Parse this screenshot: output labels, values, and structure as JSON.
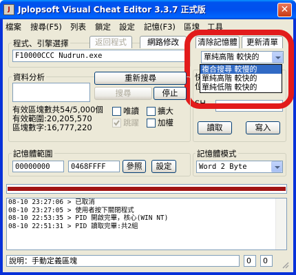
{
  "window": {
    "title": "Jplopsoft Visual Cheat Editor 3.3.7 正式版",
    "icon_text": "J",
    "close_glyph": "✕"
  },
  "menu": [
    "檔案",
    "搜尋(F5)",
    "列表",
    "鎖定",
    "設定",
    "記憶(F3)",
    "區塊",
    "工具"
  ],
  "program": {
    "group_label": "程式、引擎選擇",
    "tabs": [
      "返回程式",
      "網路修改"
    ],
    "process": "F10000CCC Nudrun.exe"
  },
  "memory_tabs": [
    "清除記憶體",
    "更新清單"
  ],
  "search_mode": {
    "selected": "單純高階 較快的",
    "options": [
      "複合搜尋 較慢的",
      "單純高階 較快的",
      "單純低階 較快的"
    ],
    "selected_index": 0
  },
  "right_panel": {
    "partial_label_1": "快",
    "partial_label_2": "位",
    "partial_label_3": "SH",
    "read_button": "讀取",
    "write_button": "寫入"
  },
  "analysis": {
    "group_label": "資料分析",
    "research_button": "重新搜尋",
    "search_button": "搜尋",
    "stop_button": "停止",
    "stats": [
      "有效區塊數共54/5,000個",
      "有效範圍:20,205,570",
      "區塊數字:16,777,220"
    ],
    "checks": {
      "readonly": "唯讀",
      "expand": "擴大",
      "skip": "跳躍",
      "weighted": "加權"
    }
  },
  "memory_range": {
    "group_label": "記憶體範圍",
    "start": "00000000",
    "end": "0468FFFF",
    "ref_button": "參照",
    "set_button": "設定"
  },
  "memory_mode": {
    "group_label": "記憶體模式",
    "selected": "Word 2 Byte"
  },
  "log": [
    "08-10 23:27:06 > 已取消",
    "08-10 23:27:05 > 使用者按下關閉程式",
    "08-10 22:53:35 > PID 開啟完畢，核心(WIN NT)",
    "08-10 22:51:31 > PID 讀取完畢:共2組"
  ],
  "status": {
    "text": "說明：手動定義區塊",
    "field1": "0",
    "field2": "0"
  },
  "colors": {
    "title_bar": "#0053ee",
    "highlight_ring": "#e21b1b",
    "selected_item": "#316ac5",
    "progress": "#a11414"
  }
}
